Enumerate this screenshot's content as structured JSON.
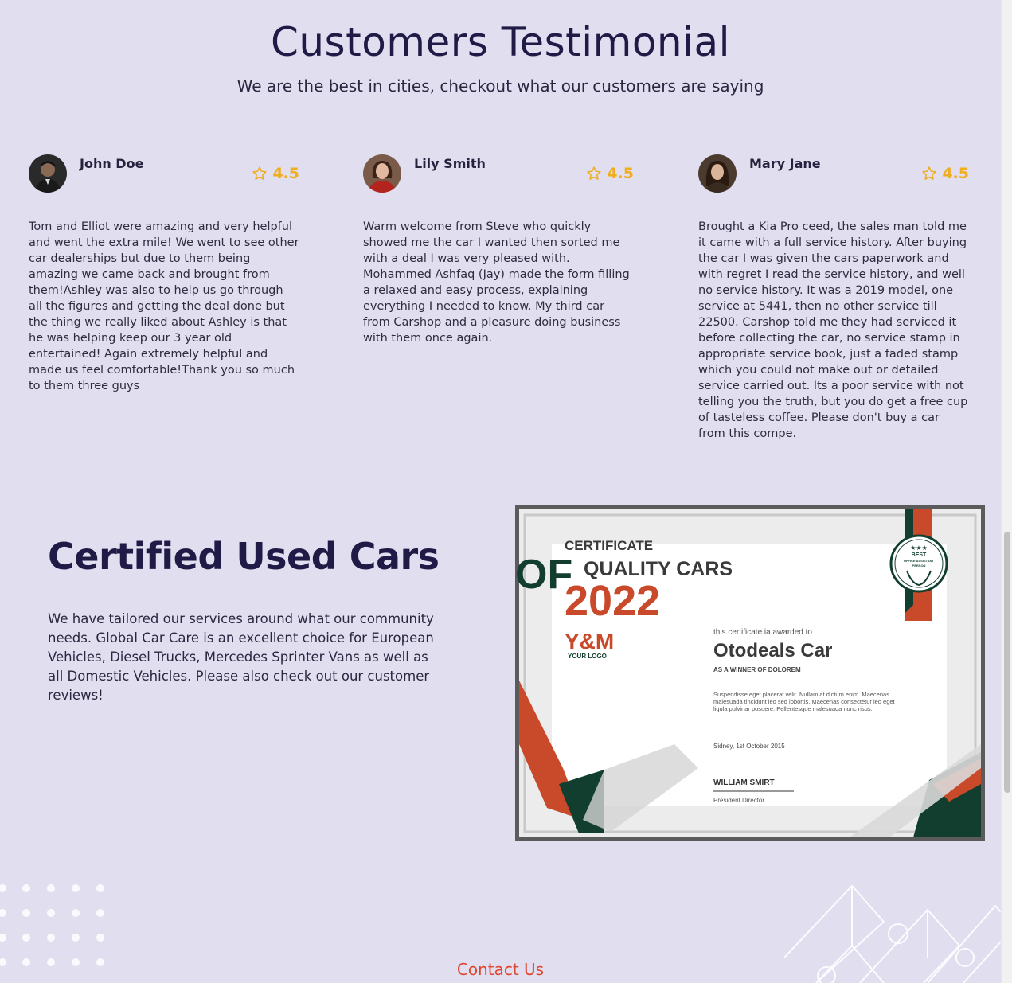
{
  "testimonials": {
    "title": "Customers Testimonial",
    "subtitle": "We are the best in cities, checkout what our customers are saying",
    "reviews": [
      {
        "name": "John Doe",
        "rating": "4.5",
        "text": "Tom and Elliot were amazing and very helpful and went the extra mile! We went to see other car dealerships but due to them being amazing we came back and brought from them!Ashley was also to help us go through all the figures and getting the deal done but the thing we really liked about Ashley is that he was helping keep our 3 year old entertained! Again extremely helpful and made us feel comfortable!Thank you so much to them three guys"
      },
      {
        "name": "Lily Smith",
        "rating": "4.5",
        "text": "Warm welcome from Steve who quickly showed me the car I wanted then sorted me with a deal I was very pleased with. Mohammed Ashfaq (Jay) made the form filling a relaxed and easy process, explaining everything I needed to know. My third car from Carshop and a pleasure doing business with them once again."
      },
      {
        "name": "Mary Jane",
        "rating": "4.5",
        "text": "Brought a Kia Pro ceed, the sales man told me it came with a full service history. After buying the car I was given the cars paperwork and with regret I read the service history, and well no service history. It was a 2019 model, one service at 5441, then no other service till 22500. Carshop told me they had serviced it before collecting the car, no service stamp in appropriate service book, just a faded stamp which you could not make out or detailed service carried out. Its a poor service with not telling you the truth, but you do get a free cup of tasteless coffee. Please don't buy a car from this compe."
      }
    ]
  },
  "certified": {
    "title": "Certified Used Cars",
    "text": "We have tailored our services around what our community needs. Global Car Care is an excellent choice for European Vehicles, Diesel Trucks, Mercedes Sprinter Vans as well as all Domestic Vehicles. Please also check out our customer reviews!",
    "certificate": {
      "label": "CERTIFICATE",
      "of": "OF",
      "subject": "QUALITY CARS",
      "year": "2022",
      "logo": "Y&M",
      "logo_caption": "YOUR LOGO",
      "awarded_to": "this certificate ia awarded to",
      "recipient": "Otodeals Car",
      "winner": "AS A WINNER OF DOLOREM",
      "body_lines": [
        "Suspendisse eget placerat velit. Nullam at dictum enim. Maecenas",
        "malesuada tincidunt leo sed lobortis. Maecenas consectetur leo eget",
        "ligula pulvinar posuere. Pellentesque malesuada nunc risus."
      ],
      "date": "Sidney, 1st October 2015",
      "signer": "WILLIAM SMIRT",
      "signer_title": "President Director",
      "seal_line1": "BEST",
      "seal_line2": "OFFICE ASSISTANT",
      "seal_line3": "PERSON"
    }
  },
  "footer": {
    "contact_label": "Contact Us"
  },
  "colors": {
    "background": "#e1def0",
    "heading": "#1f1b46",
    "star": "#f0ad1d",
    "contact": "#e0452e",
    "cert_orange": "#c94a2a",
    "cert_green": "#123e30"
  },
  "icons": [
    "star-outline-icon",
    "avatar-photo",
    "dot-grid-decoration",
    "geometric-line-decoration"
  ]
}
